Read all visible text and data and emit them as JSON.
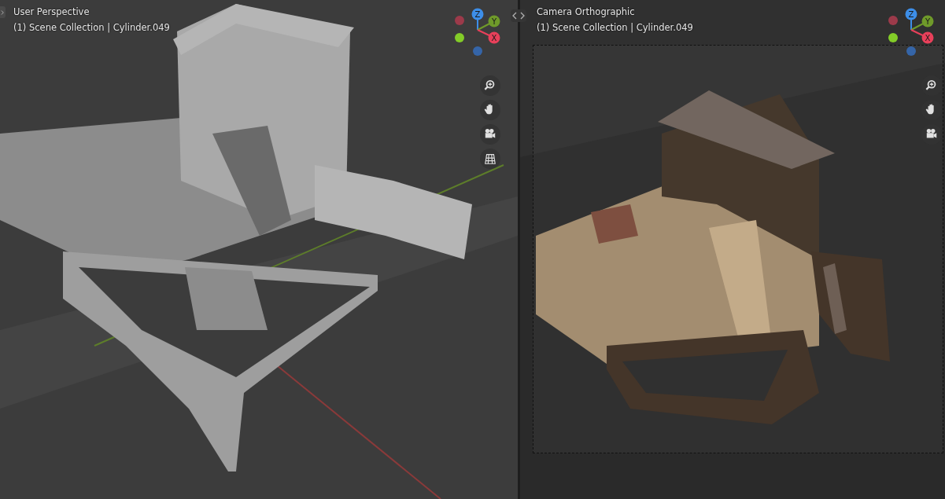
{
  "viewports": [
    {
      "view": "User Perspective",
      "collection": "(1) Scene Collection | Cylinder.049",
      "kind": "solid",
      "camera_frame": false,
      "gizmo": {
        "x": "X",
        "y": "Y",
        "z": "Z"
      },
      "nav_tools": [
        {
          "kind": "zoom"
        },
        {
          "kind": "pan"
        },
        {
          "kind": "camera"
        },
        {
          "kind": "ortho"
        }
      ]
    },
    {
      "view": "Camera Orthographic",
      "collection": "(1) Scene Collection | Cylinder.049",
      "kind": "rendered",
      "camera_frame": true,
      "gizmo": {
        "x": "X",
        "y": "Y",
        "z": "Z"
      },
      "nav_tools": [
        {
          "kind": "zoom"
        },
        {
          "kind": "pan"
        },
        {
          "kind": "camera"
        }
      ]
    }
  ]
}
